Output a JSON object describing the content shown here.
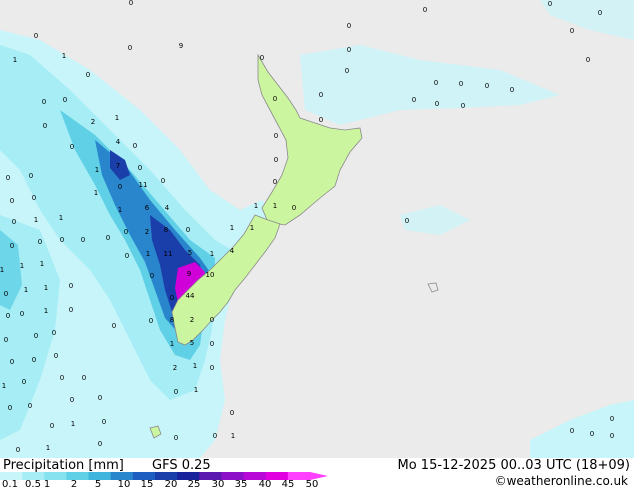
{
  "legend": {
    "title": "Precipitation [mm]",
    "model": "GFS 0.25",
    "valid_time": "Mo 15-12-2025 00..03 UTC (18+09)",
    "credit": "©weatheronline.co.uk",
    "ticks": [
      "0.1",
      "0.5",
      "1",
      "2",
      "5",
      "10",
      "15",
      "20",
      "25",
      "30",
      "35",
      "40",
      "45",
      "50"
    ],
    "colors": [
      "#c8f5fa",
      "#a6edf5",
      "#86e2ef",
      "#5fd0e6",
      "#3fb4dc",
      "#2a86cc",
      "#1e5ec0",
      "#1a3eaa",
      "#18229a",
      "#5a18b0",
      "#8c10c8",
      "#b808d8",
      "#e000e0",
      "#ff40ff"
    ]
  },
  "map": {
    "background_color": "#ebebeb",
    "land_color": "#ccf5a0",
    "coast_color": "#8a8a8a",
    "precip_colors": {
      "light": "#c8f5fa",
      "low": "#a6edf5",
      "mid": "#5fd0e6",
      "high": "#2a86cc",
      "heavy": "#1a3eaa",
      "extreme": "#d000d8"
    }
  },
  "labels": [
    {
      "v": "0",
      "lon": 131,
      "lat": 5
    },
    {
      "v": "0",
      "lon": 425,
      "lat": 12
    },
    {
      "v": "0",
      "lon": 550,
      "lat": 6
    },
    {
      "v": "0",
      "lon": 600,
      "lat": 15
    },
    {
      "v": "0",
      "lon": 36,
      "lat": 38
    },
    {
      "v": "0",
      "lon": 349,
      "lat": 28
    },
    {
      "v": "0",
      "lon": 572,
      "lat": 33
    },
    {
      "v": "0",
      "lon": 130,
      "lat": 50
    },
    {
      "v": "9",
      "lon": 181,
      "lat": 48
    },
    {
      "v": "0",
      "lon": 349,
      "lat": 52
    },
    {
      "v": "1",
      "lon": 15,
      "lat": 62
    },
    {
      "v": "1",
      "lon": 64,
      "lat": 58
    },
    {
      "v": "0",
      "lon": 262,
      "lat": 60
    },
    {
      "v": "0",
      "lon": 588,
      "lat": 62
    },
    {
      "v": "0",
      "lon": 347,
      "lat": 73
    },
    {
      "v": "0",
      "lon": 88,
      "lat": 77
    },
    {
      "v": "0",
      "lon": 436,
      "lat": 85
    },
    {
      "v": "0",
      "lon": 461,
      "lat": 86
    },
    {
      "v": "0",
      "lon": 487,
      "lat": 88
    },
    {
      "v": "0",
      "lon": 512,
      "lat": 92
    },
    {
      "v": "0",
      "lon": 44,
      "lat": 104
    },
    {
      "v": "0",
      "lon": 65,
      "lat": 102
    },
    {
      "v": "0",
      "lon": 321,
      "lat": 97
    },
    {
      "v": "0",
      "lon": 275,
      "lat": 101
    },
    {
      "v": "0",
      "lon": 414,
      "lat": 102
    },
    {
      "v": "0",
      "lon": 437,
      "lat": 106
    },
    {
      "v": "0",
      "lon": 463,
      "lat": 108
    },
    {
      "v": "2",
      "lon": 93,
      "lat": 124
    },
    {
      "v": "1",
      "lon": 117,
      "lat": 120
    },
    {
      "v": "0",
      "lon": 321,
      "lat": 122
    },
    {
      "v": "0",
      "lon": 276,
      "lat": 138
    },
    {
      "v": "0",
      "lon": 45,
      "lat": 128
    },
    {
      "v": "0",
      "lon": 72,
      "lat": 149
    },
    {
      "v": "4",
      "lon": 118,
      "lat": 144
    },
    {
      "v": "0",
      "lon": 135,
      "lat": 148
    },
    {
      "v": "0",
      "lon": 276,
      "lat": 162
    },
    {
      "v": "0",
      "lon": 275,
      "lat": 184
    },
    {
      "v": "7",
      "lon": 118,
      "lat": 168
    },
    {
      "v": "0",
      "lon": 140,
      "lat": 170
    },
    {
      "v": "0",
      "lon": 8,
      "lat": 180
    },
    {
      "v": "0",
      "lon": 31,
      "lat": 178
    },
    {
      "v": "1",
      "lon": 97,
      "lat": 172
    },
    {
      "v": "11",
      "lon": 143,
      "lat": 187
    },
    {
      "v": "0",
      "lon": 163,
      "lat": 183
    },
    {
      "v": "0",
      "lon": 120,
      "lat": 189
    },
    {
      "v": "0",
      "lon": 12,
      "lat": 203
    },
    {
      "v": "0",
      "lon": 34,
      "lat": 200
    },
    {
      "v": "1",
      "lon": 96,
      "lat": 195
    },
    {
      "v": "6",
      "lon": 147,
      "lat": 210
    },
    {
      "v": "4",
      "lon": 167,
      "lat": 210
    },
    {
      "v": "1",
      "lon": 120,
      "lat": 212
    },
    {
      "v": "1",
      "lon": 256,
      "lat": 208
    },
    {
      "v": "1",
      "lon": 275,
      "lat": 208
    },
    {
      "v": "0",
      "lon": 294,
      "lat": 210
    },
    {
      "v": "0",
      "lon": 14,
      "lat": 224
    },
    {
      "v": "1",
      "lon": 36,
      "lat": 222
    },
    {
      "v": "1",
      "lon": 61,
      "lat": 220
    },
    {
      "v": "2",
      "lon": 147,
      "lat": 234
    },
    {
      "v": "8",
      "lon": 166,
      "lat": 232
    },
    {
      "v": "0",
      "lon": 188,
      "lat": 232
    },
    {
      "v": "1",
      "lon": 232,
      "lat": 230
    },
    {
      "v": "1",
      "lon": 252,
      "lat": 230
    },
    {
      "v": "0",
      "lon": 407,
      "lat": 223
    },
    {
      "v": "0",
      "lon": 12,
      "lat": 248
    },
    {
      "v": "0",
      "lon": 40,
      "lat": 244
    },
    {
      "v": "0",
      "lon": 62,
      "lat": 242
    },
    {
      "v": "0",
      "lon": 83,
      "lat": 242
    },
    {
      "v": "0",
      "lon": 108,
      "lat": 240
    },
    {
      "v": "0",
      "lon": 126,
      "lat": 234
    },
    {
      "v": "1",
      "lon": 148,
      "lat": 256
    },
    {
      "v": "11",
      "lon": 168,
      "lat": 256
    },
    {
      "v": "5",
      "lon": 190,
      "lat": 255
    },
    {
      "v": "1",
      "lon": 212,
      "lat": 256
    },
    {
      "v": "4",
      "lon": 232,
      "lat": 253
    },
    {
      "v": "1",
      "lon": 2,
      "lat": 272
    },
    {
      "v": "1",
      "lon": 22,
      "lat": 268
    },
    {
      "v": "1",
      "lon": 42,
      "lat": 266
    },
    {
      "v": "0",
      "lon": 127,
      "lat": 258
    },
    {
      "v": "0",
      "lon": 152,
      "lat": 278
    },
    {
      "v": "9",
      "lon": 189,
      "lat": 276
    },
    {
      "v": "10",
      "lon": 210,
      "lat": 277
    },
    {
      "v": "0",
      "lon": 6,
      "lat": 296
    },
    {
      "v": "1",
      "lon": 26,
      "lat": 292
    },
    {
      "v": "1",
      "lon": 46,
      "lat": 290
    },
    {
      "v": "0",
      "lon": 71,
      "lat": 288
    },
    {
      "v": "0",
      "lon": 172,
      "lat": 300
    },
    {
      "v": "44",
      "lon": 190,
      "lat": 298
    },
    {
      "v": "0",
      "lon": 8,
      "lat": 318
    },
    {
      "v": "0",
      "lon": 22,
      "lat": 316
    },
    {
      "v": "1",
      "lon": 46,
      "lat": 313
    },
    {
      "v": "0",
      "lon": 71,
      "lat": 312
    },
    {
      "v": "0",
      "lon": 151,
      "lat": 323
    },
    {
      "v": "8",
      "lon": 172,
      "lat": 322
    },
    {
      "v": "2",
      "lon": 192,
      "lat": 322
    },
    {
      "v": "0",
      "lon": 212,
      "lat": 322
    },
    {
      "v": "0",
      "lon": 6,
      "lat": 342
    },
    {
      "v": "0",
      "lon": 36,
      "lat": 338
    },
    {
      "v": "0",
      "lon": 54,
      "lat": 335
    },
    {
      "v": "0",
      "lon": 114,
      "lat": 328
    },
    {
      "v": "1",
      "lon": 172,
      "lat": 346
    },
    {
      "v": "5",
      "lon": 192,
      "lat": 345
    },
    {
      "v": "0",
      "lon": 212,
      "lat": 346
    },
    {
      "v": "0",
      "lon": 12,
      "lat": 364
    },
    {
      "v": "0",
      "lon": 34,
      "lat": 362
    },
    {
      "v": "0",
      "lon": 56,
      "lat": 358
    },
    {
      "v": "2",
      "lon": 175,
      "lat": 370
    },
    {
      "v": "1",
      "lon": 195,
      "lat": 368
    },
    {
      "v": "0",
      "lon": 212,
      "lat": 370
    },
    {
      "v": "1",
      "lon": 4,
      "lat": 388
    },
    {
      "v": "0",
      "lon": 24,
      "lat": 384
    },
    {
      "v": "0",
      "lon": 62,
      "lat": 380
    },
    {
      "v": "0",
      "lon": 84,
      "lat": 380
    },
    {
      "v": "0",
      "lon": 176,
      "lat": 394
    },
    {
      "v": "1",
      "lon": 196,
      "lat": 392
    },
    {
      "v": "0",
      "lon": 10,
      "lat": 410
    },
    {
      "v": "0",
      "lon": 30,
      "lat": 408
    },
    {
      "v": "0",
      "lon": 72,
      "lat": 402
    },
    {
      "v": "0",
      "lon": 100,
      "lat": 400
    },
    {
      "v": "0",
      "lon": 232,
      "lat": 415
    },
    {
      "v": "0",
      "lon": 52,
      "lat": 428
    },
    {
      "v": "1",
      "lon": 73,
      "lat": 426
    },
    {
      "v": "0",
      "lon": 104,
      "lat": 424
    },
    {
      "v": "0",
      "lon": 612,
      "lat": 421
    },
    {
      "v": "0",
      "lon": 18,
      "lat": 452
    },
    {
      "v": "1",
      "lon": 48,
      "lat": 450
    },
    {
      "v": "0",
      "lon": 100,
      "lat": 446
    },
    {
      "v": "0",
      "lon": 176,
      "lat": 440
    },
    {
      "v": "0",
      "lon": 215,
      "lat": 438
    },
    {
      "v": "1",
      "lon": 233,
      "lat": 438
    },
    {
      "v": "0",
      "lon": 572,
      "lat": 433
    },
    {
      "v": "0",
      "lon": 592,
      "lat": 436
    },
    {
      "v": "0",
      "lon": 612,
      "lat": 438
    }
  ]
}
